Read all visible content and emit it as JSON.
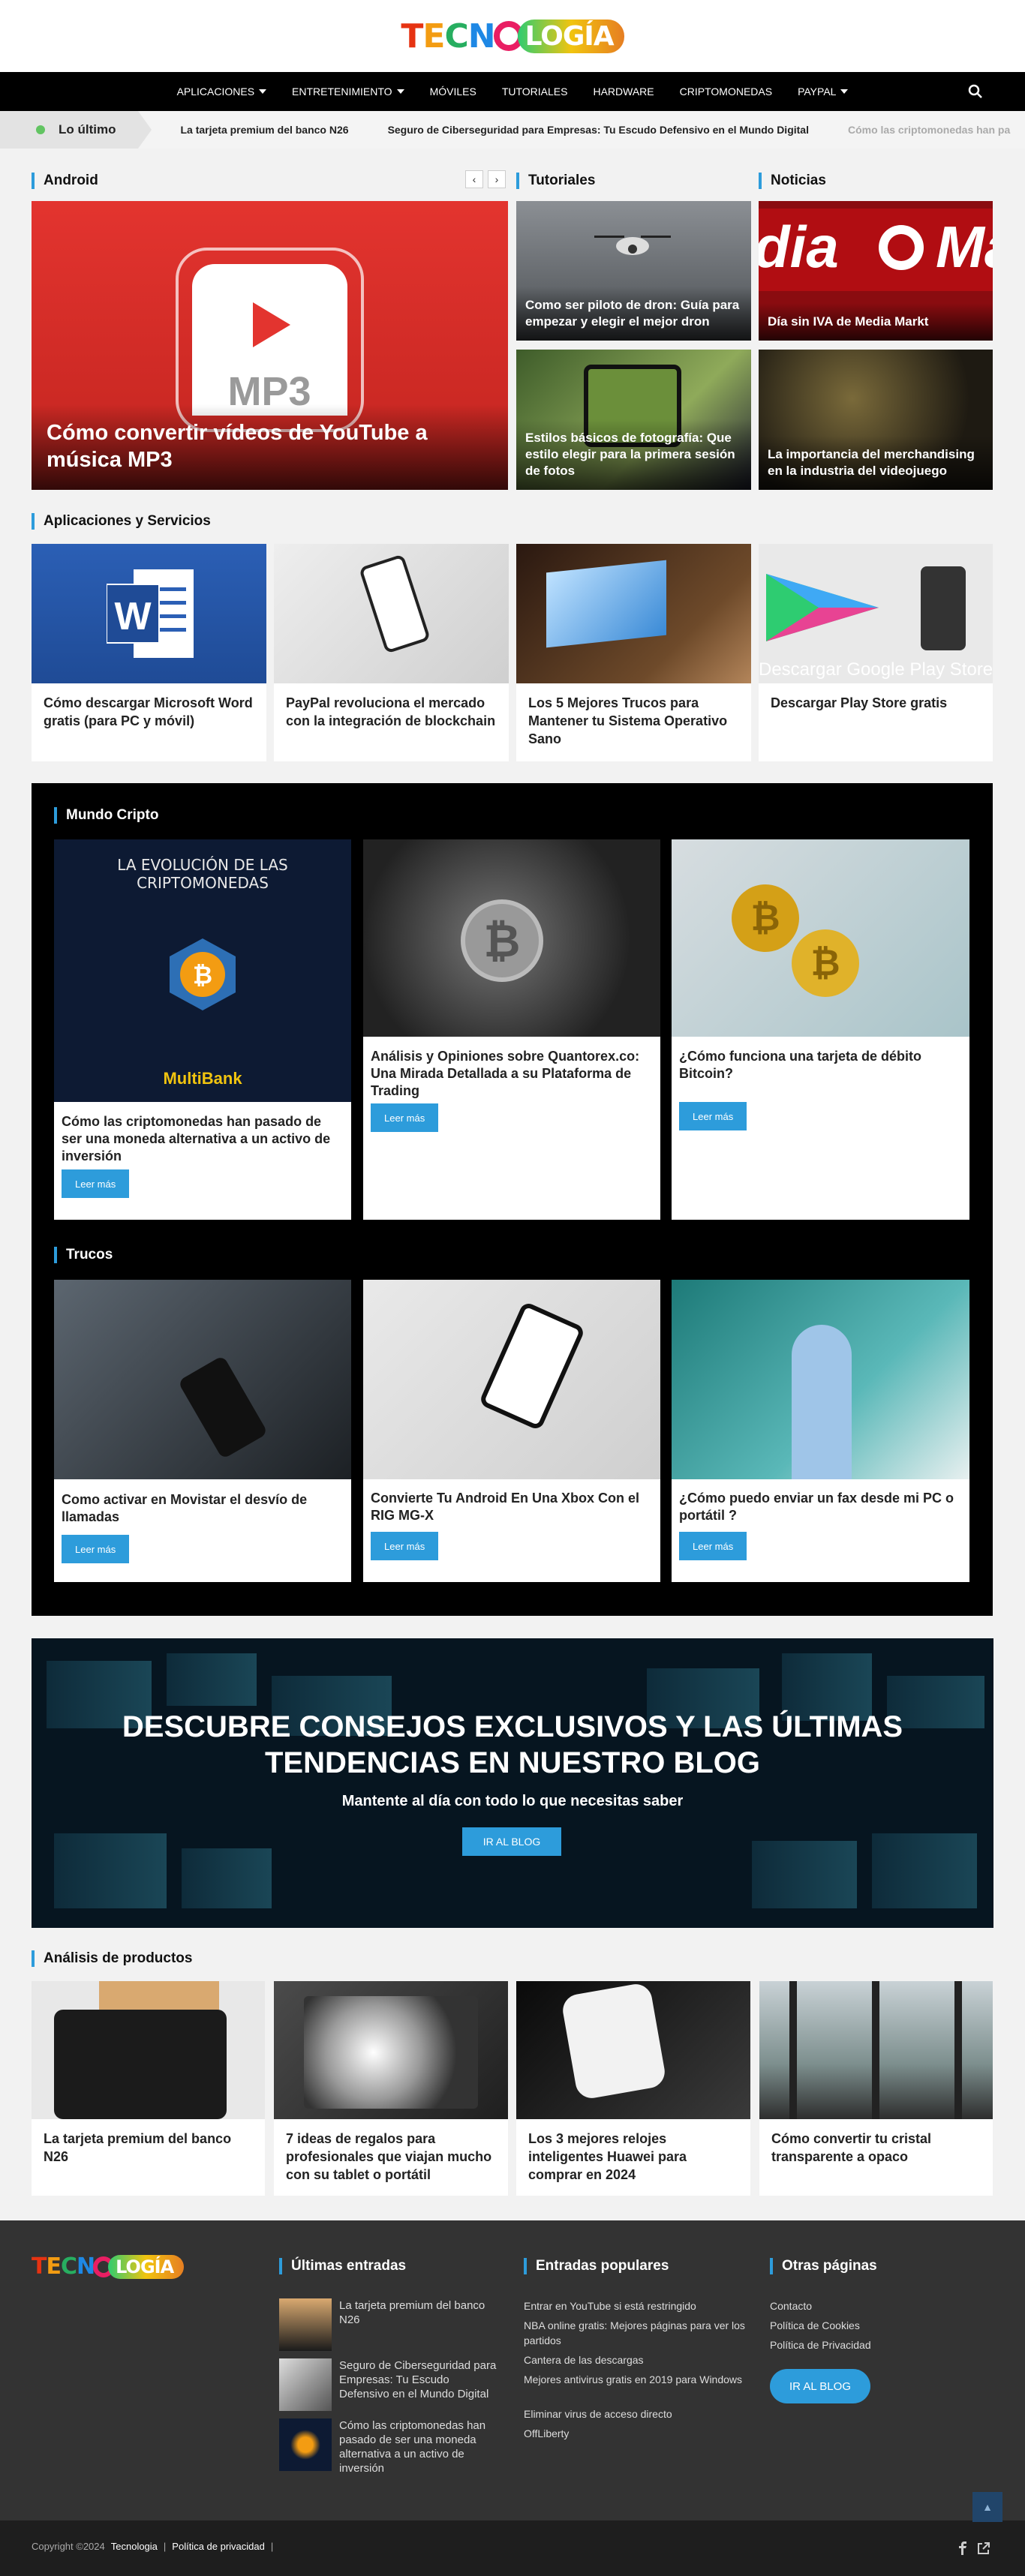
{
  "header": {
    "logo_text": "TECNOLOGÍA",
    "logo_a": "TECN",
    "logo_b": "LOGÍA"
  },
  "nav": {
    "items": [
      {
        "label": "APLICACIONES",
        "dropdown": true
      },
      {
        "label": "ENTRETENIMIENTO",
        "dropdown": true
      },
      {
        "label": "MÓVILES",
        "dropdown": false
      },
      {
        "label": "TUTORIALES",
        "dropdown": false
      },
      {
        "label": "HARDWARE",
        "dropdown": false
      },
      {
        "label": "CRIPTOMONEDAS",
        "dropdown": false
      },
      {
        "label": "PAYPAL",
        "dropdown": true
      }
    ],
    "search_icon": "search-icon"
  },
  "ticker": {
    "label": "Lo último",
    "items": [
      "La tarjeta premium del banco N26",
      "Seguro de Ciberseguridad para Empresas: Tu Escudo Defensivo en el Mundo Digital",
      "Cómo las criptomonedas han pa"
    ]
  },
  "android": {
    "heading": "Android",
    "feature": "Cómo convertir vídeos de YouTube a música MP3",
    "feature_image_text": "MP3"
  },
  "tutoriales": {
    "heading": "Tutoriales",
    "items": [
      "Como ser piloto de dron: Guía para empezar y elegir el mejor dron",
      "Estilos básicos de fotografía: Que estilo elegir para la primera sesión de fotos"
    ]
  },
  "noticias": {
    "heading": "Noticias",
    "items": [
      "Día sin IVA de Media Markt",
      "La importancia del merchandising en la industria del videojuego"
    ]
  },
  "apps": {
    "heading": "Aplicaciones y Servicios",
    "items": [
      "Cómo descargar Microsoft Word gratis (para PC y móvil)",
      "PayPal revoluciona el mercado con la integración de blockchain",
      "Los 5 Mejores Trucos para Mantener tu Sistema Operativo Sano",
      "Descargar Play Store gratis"
    ],
    "play_image_text": "Descargar Google Play Store"
  },
  "cripto": {
    "heading": "Mundo Cripto",
    "image_title": "LA EVOLUCIÓN DE LAS CRIPTOMONEDAS",
    "image_brand": "MultiBank",
    "items": [
      "Cómo las criptomonedas han pasado de ser una moneda alternativa a un activo de inversión",
      "Análisis y Opiniones sobre Quantorex.co: Una Mirada Detallada a su Plataforma de Trading",
      "¿Cómo funciona una tarjeta de débito Bitcoin?"
    ],
    "read_more": "Leer más"
  },
  "trucos": {
    "heading": "Trucos",
    "items": [
      "Como activar en Movistar el desvío de llamadas",
      "Convierte Tu Android En Una Xbox Con el RIG MG-X",
      "¿Cómo puedo enviar un fax desde mi PC o portátil ?"
    ],
    "read_more": "Leer más"
  },
  "banner": {
    "title": "Descubre consejos exclusivos y las últimas tendencias en nuestro blog",
    "subtitle": "Mantente al día con todo lo que necesitas saber",
    "button": "IR AL BLOG"
  },
  "productos": {
    "heading": "Análisis de productos",
    "items": [
      "La tarjeta premium del banco N26",
      "7 ideas de regalos para profesionales que viajan mucho con su tablet o portátil",
      "Los 3 mejores relojes inteligentes Huawei para comprar en 2024",
      "Cómo convertir tu cristal transparente a opaco"
    ]
  },
  "footer": {
    "ultimas_heading": "Últimas entradas",
    "ultimas": [
      "La tarjeta premium del banco N26",
      "Seguro de Ciberseguridad para Empresas: Tu Escudo Defensivo en el Mundo Digital",
      "Cómo las criptomonedas han pasado de ser una moneda alternativa a un activo de inversión"
    ],
    "populares_heading": "Entradas populares",
    "populares": [
      "Entrar en YouTube si está restringido",
      "NBA online gratis: Mejores páginas para ver los partidos",
      "Cantera de las descargas",
      "Mejores antivirus gratis en 2019 para Windows",
      "Eliminar virus de acceso directo",
      "OffLiberty"
    ],
    "otras_heading": "Otras páginas",
    "otras": [
      "Contacto",
      "Política de Cookies",
      "Política de Privacidad"
    ],
    "button": "IR AL BLOG",
    "copyright": "Copyright ©2024",
    "site": "Tecnologia",
    "privacy": "Política de privacidad",
    "separator": "|",
    "social_icons": [
      "facebook-icon",
      "external-link-icon"
    ],
    "to_top_icon": "chevron-up-icon"
  },
  "colors": {
    "accent": "#2d9cdb",
    "nav_bg": "#000000",
    "footer_bg": "#333333"
  }
}
